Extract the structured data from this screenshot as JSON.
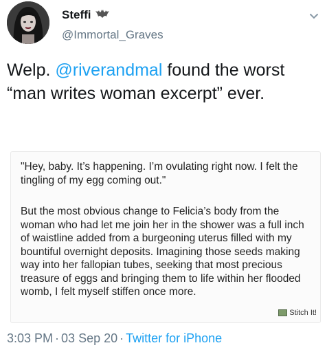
{
  "tweet": {
    "display_name": "Steffi",
    "handle": "@Immortal_Graves",
    "text_before": "Welp. ",
    "mention": "@riverandmal",
    "text_after": " found the worst “man writes woman excerpt” ever.",
    "time": "3:03 PM",
    "date": "03 Sep 20",
    "source": "Twitter for iPhone",
    "separator": "·"
  },
  "quote": {
    "paragraph_1": "\"Hey, baby. It’s happening. I’m ovulating right now. I felt the tingling of my egg coming out.\"",
    "paragraph_2": "But the most obvious change to Felicia’s body from the woman who had let me join her in the shower was a full inch of waistline added from a burgeoning uterus filled with my bountiful overnight deposits. Imagining those seeds making way into her fallopian tubes, seeking that most precious treasure of eggs and bringing them to life within her flooded womb, I felt myself stiffen once more.",
    "watermark": "Stitch It!"
  },
  "icons": {
    "badge": "bat-icon",
    "menu": "chevron-down-icon",
    "watermark": "stitch-icon"
  },
  "colors": {
    "link": "#1da1f2",
    "secondary_text": "#657786",
    "primary_text": "#14171a"
  }
}
